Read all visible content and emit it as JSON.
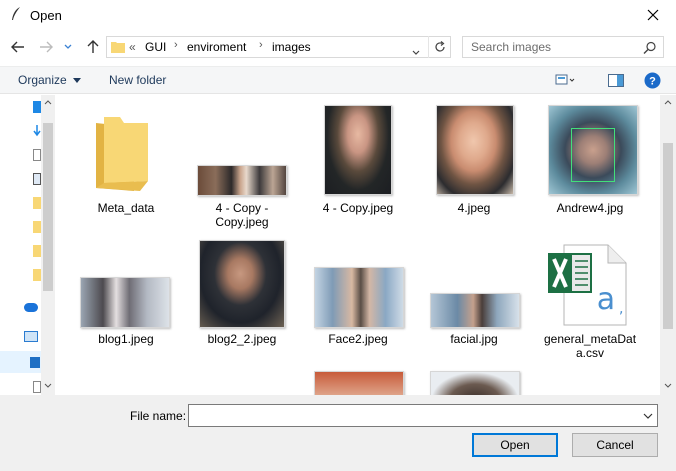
{
  "window": {
    "title": "Open"
  },
  "address": {
    "overflow": "«",
    "crumbs": [
      "GUI",
      "enviroment",
      "images"
    ],
    "search_placeholder": "Search images"
  },
  "toolbar": {
    "organize": "Organize",
    "new_folder": "New folder"
  },
  "files": [
    {
      "name": "Meta_data",
      "kind": "folder"
    },
    {
      "name": "4 - Copy -\nCopy.jpeg",
      "kind": "image"
    },
    {
      "name": "4 - Copy.jpeg",
      "kind": "image"
    },
    {
      "name": "4.jpeg",
      "kind": "image"
    },
    {
      "name": "Andrew4.jpg",
      "kind": "image"
    },
    {
      "name": "blog1.jpeg",
      "kind": "image"
    },
    {
      "name": "blog2_2.jpeg",
      "kind": "image"
    },
    {
      "name": "Face2.jpeg",
      "kind": "image"
    },
    {
      "name": "facial.jpg",
      "kind": "image"
    },
    {
      "name": "general_metaDat\na.csv",
      "kind": "csv"
    }
  ],
  "bottom": {
    "file_name_label": "File name:",
    "file_name_value": "",
    "open_label": "Open",
    "cancel_label": "Cancel"
  },
  "colors": {
    "accent": "#0078d7",
    "folder": "#f8d775",
    "excel": "#1d7044"
  }
}
